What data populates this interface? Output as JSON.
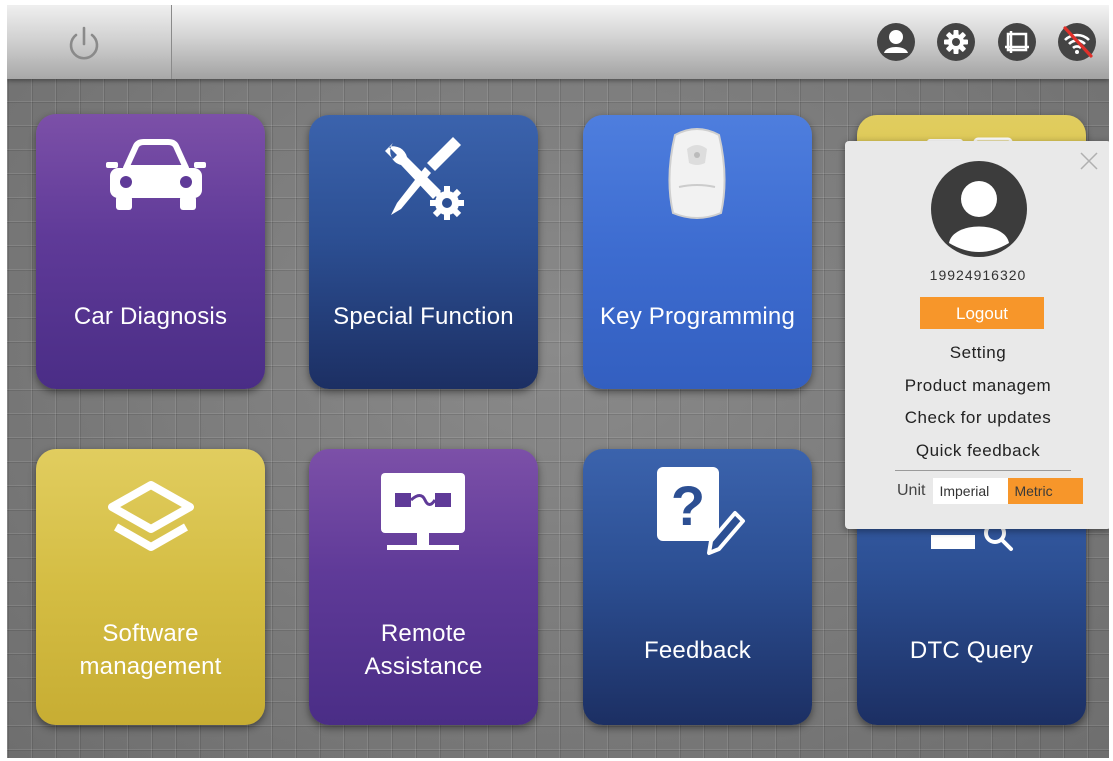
{
  "colors": {
    "accent_orange": "#f7962a",
    "tile_purple": "#5f3a98",
    "tile_navy": "#2c4f93",
    "tile_blue": "#3d6cd0",
    "tile_yellow": "#d4bd43",
    "popup_bg": "#e9e9e9",
    "wifi_off_slash": "#e0302a"
  },
  "topbar": {
    "power_icon": "power-icon",
    "icons": [
      "user-icon",
      "gear-icon",
      "screenshot-icon",
      "wifi-off-icon"
    ]
  },
  "tiles": [
    {
      "label": "Car Diagnosis",
      "icon": "car-icon"
    },
    {
      "label": "Special Function",
      "icon": "wrench-screwdriver-gear-icon"
    },
    {
      "label": "Key Programming",
      "icon": "car-key-fob-icon"
    },
    {
      "label": "",
      "icon": "partially-hidden-icon"
    },
    {
      "label_line1": "Software",
      "label_line2": "management",
      "icon": "layers-icon"
    },
    {
      "label_line1": "Remote",
      "label_line2": "Assistance",
      "icon": "remote-monitor-icon"
    },
    {
      "label": "Feedback",
      "icon": "question-edit-icon"
    },
    {
      "label": "DTC Query",
      "icon": "search-document-icon"
    }
  ],
  "user_popup": {
    "user_id": "19924916320",
    "logout_label": "Logout",
    "menu": [
      "Setting",
      "Product managem",
      "Check for updates",
      "Quick feedback"
    ],
    "unit_label": "Unit",
    "unit_options": [
      "Imperial",
      "Metric"
    ],
    "unit_selected": "Metric"
  }
}
